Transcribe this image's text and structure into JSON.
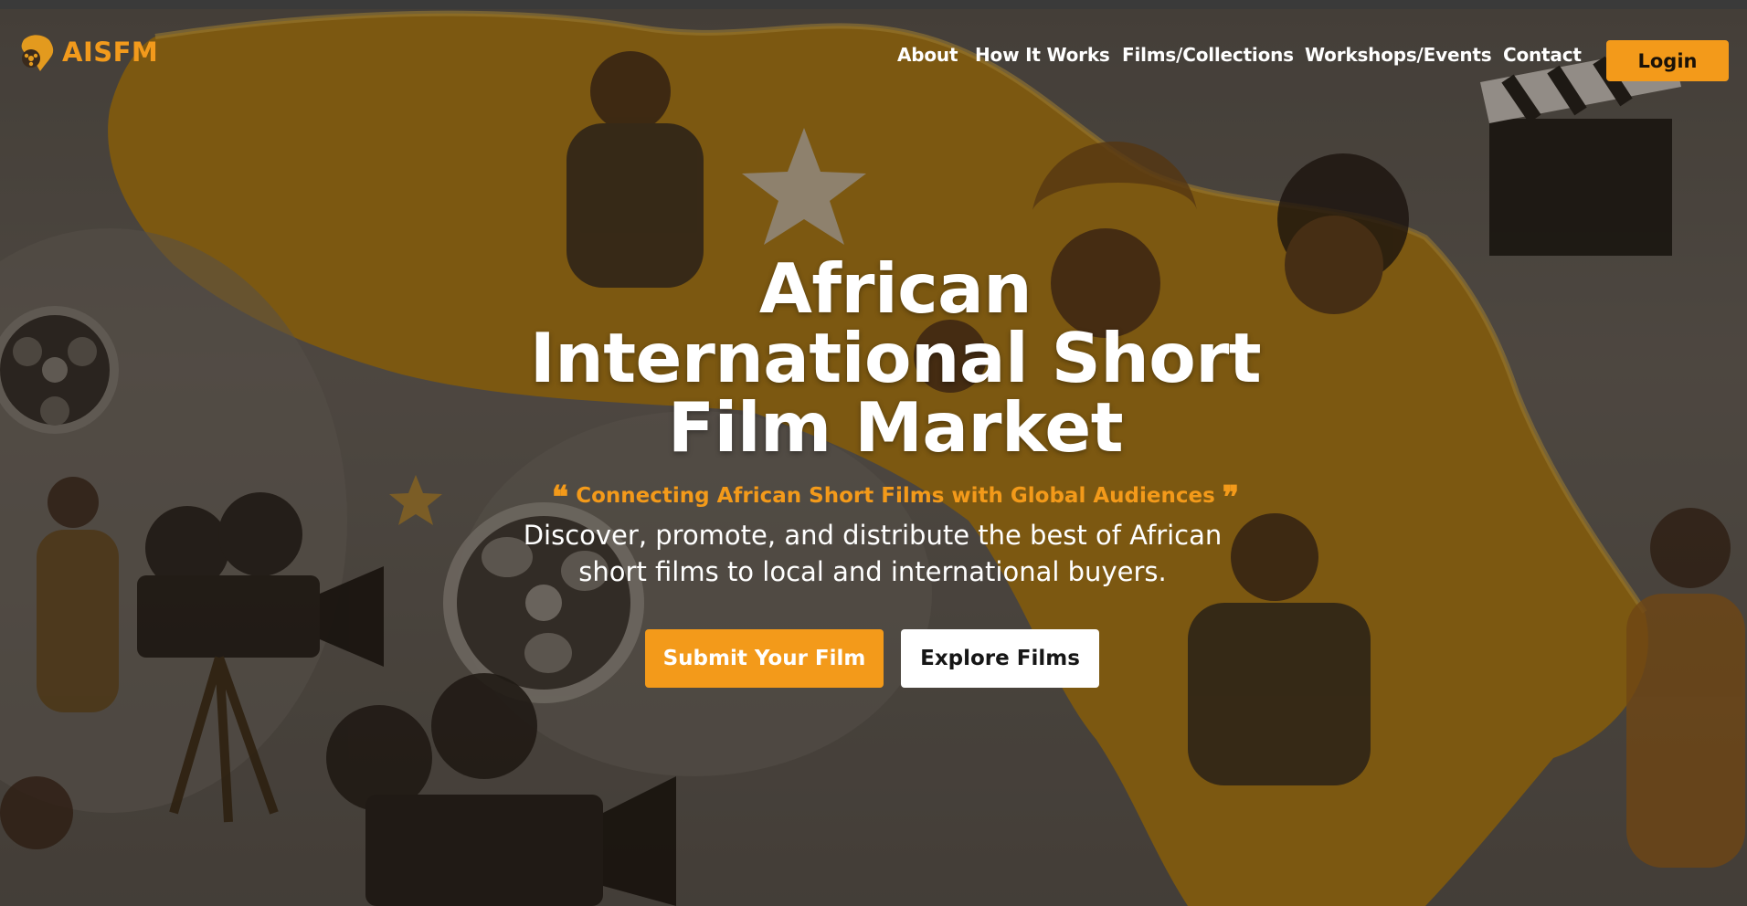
{
  "brand": {
    "name": "AISFM",
    "logo_icon": "africa-film-reel-logo"
  },
  "nav": {
    "items": [
      "About",
      "How It Works",
      "Films/Collections",
      "Workshops/Events",
      "Contact"
    ],
    "login_label": "Login"
  },
  "hero": {
    "title_lines": [
      "African",
      "International Short",
      "Film Market"
    ],
    "tagline": "Connecting African Short Films with Global Audiences",
    "description_lines": [
      "Discover, promote, and distribute the best of African",
      "short films to local and international buyers."
    ],
    "primary_button": "Submit Your Film",
    "secondary_button": "Explore Films"
  },
  "colors": {
    "accent": "#f39a1a",
    "text": "#ffffff",
    "button_light": "#ffffff"
  }
}
